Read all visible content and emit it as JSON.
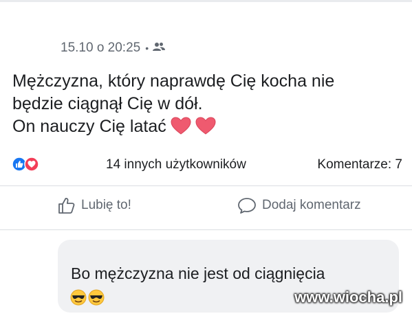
{
  "post": {
    "timestamp": "15.10 o 20:25",
    "separator": "•",
    "audience_icon": "friends-icon",
    "text_lines": [
      "Mężczyzna, który naprawdę Cię kocha nie",
      "będzie ciągnął Cię w dół.",
      "On nauczy Cię latać"
    ],
    "text_emojis": [
      "heart-emoji",
      "heart-emoji"
    ],
    "reactions": {
      "icons": [
        "like-reaction-icon",
        "love-reaction-icon"
      ],
      "others_text": "14 innych użytkowników",
      "comments_text": "Komentarze: 7"
    },
    "actions": {
      "like_label": "Lubię to!",
      "comment_label": "Dodaj komentarz"
    }
  },
  "comment": {
    "text": "Bo mężczyzna nie jest od ciągnięcia",
    "emojis": [
      "sunglasses-emoji",
      "sunglasses-emoji"
    ]
  },
  "watermark": "www.wiocha.pl",
  "colors": {
    "text": "#1c1e21",
    "secondary": "#606770",
    "like_blue": "#1877f2",
    "love_red": "#f33e58",
    "heart": "#ef5a6f",
    "comment_bg": "#f0f1f3"
  }
}
